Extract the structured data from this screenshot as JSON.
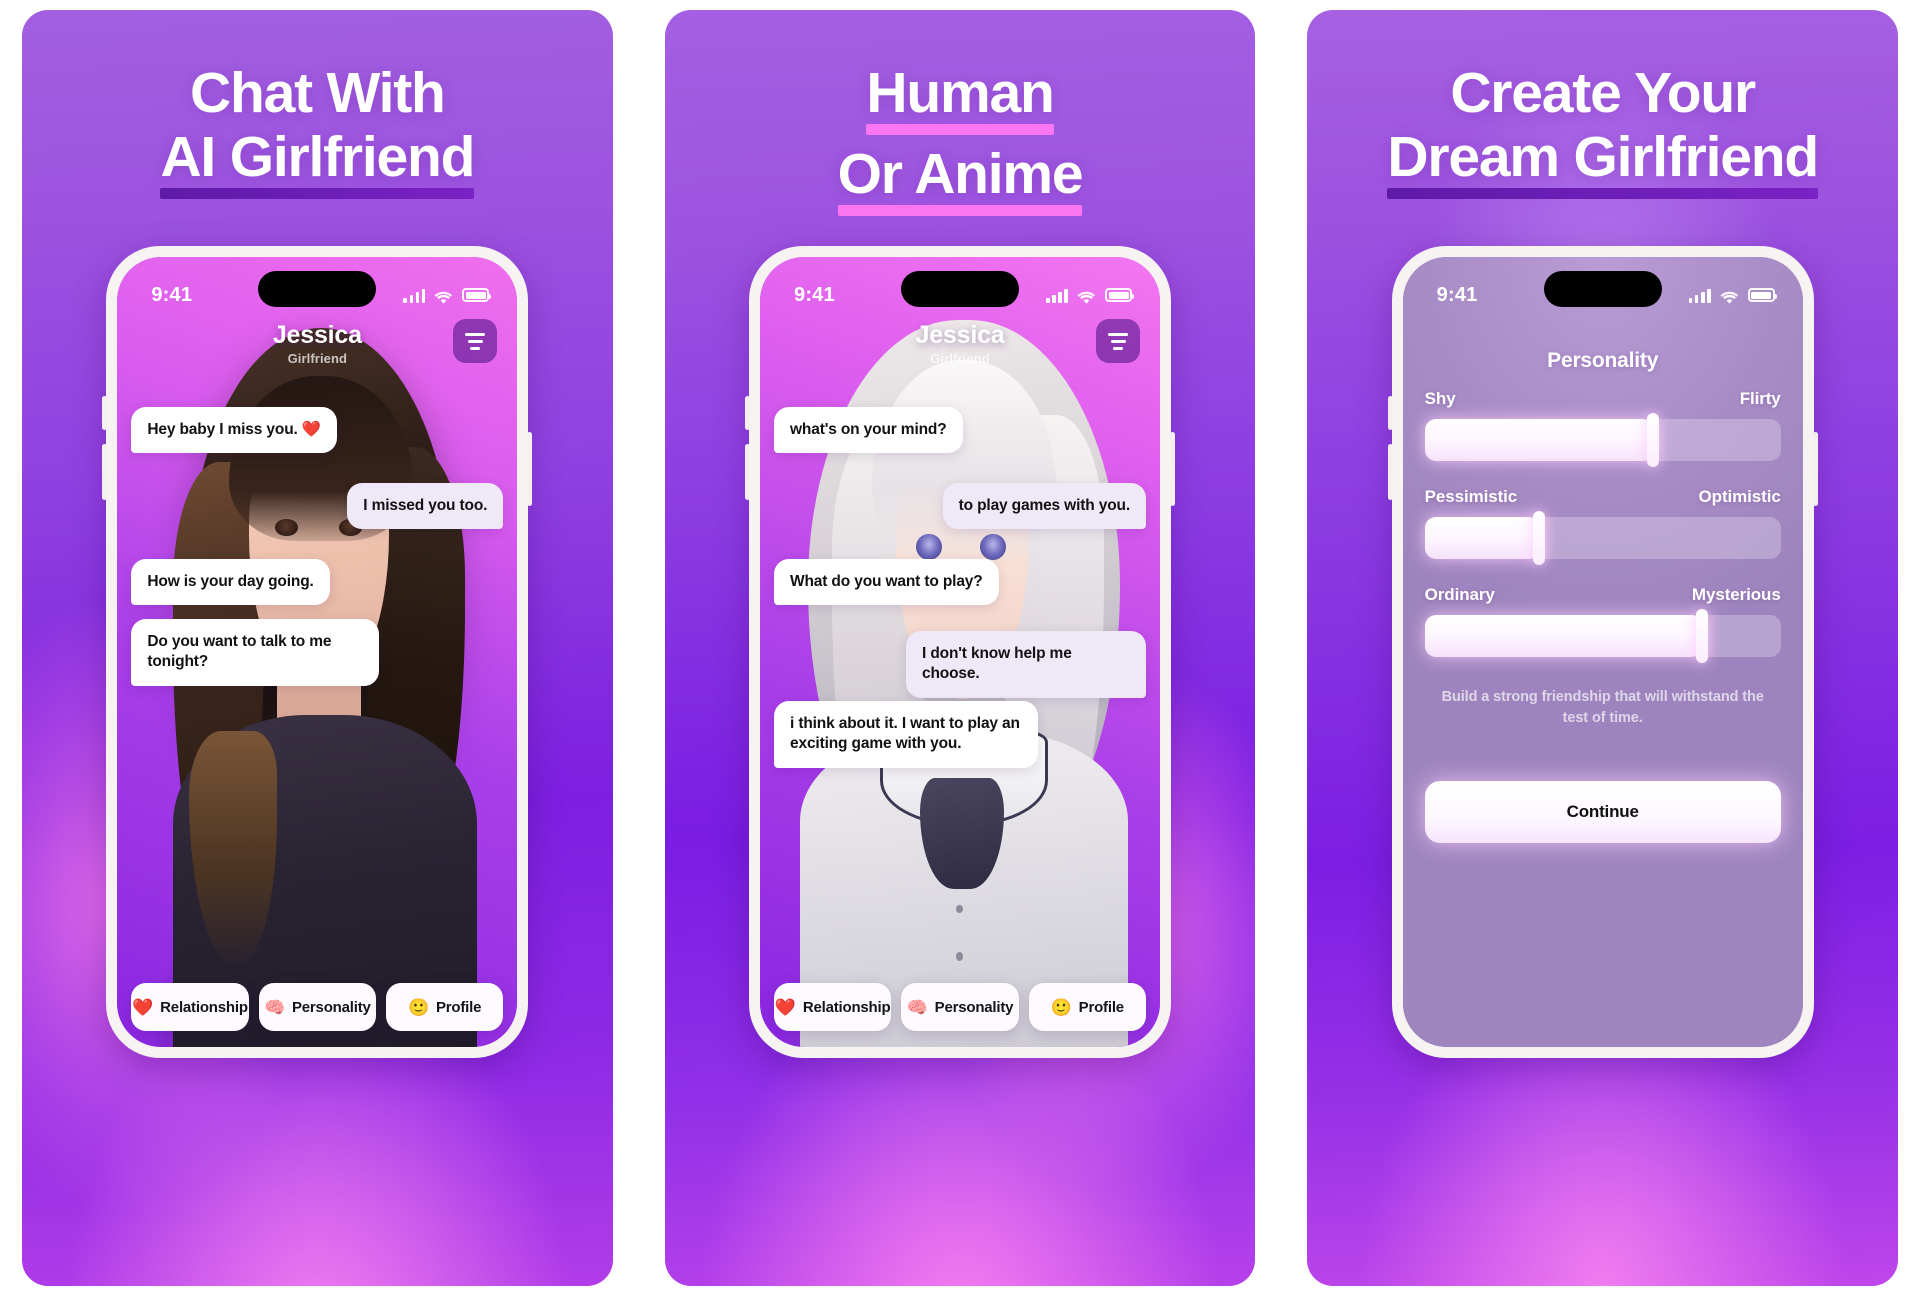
{
  "panels": [
    {
      "headline_line1": "Chat With",
      "headline_line2": "AI Girlfriend",
      "underline_color": "#6b1eb4",
      "status": {
        "time": "9:41"
      },
      "chat": {
        "name": "Jessica",
        "subtitle": "Girlfriend",
        "messages": [
          {
            "from": "in",
            "text": "Hey baby I miss you. ❤️"
          },
          {
            "from": "out",
            "text": "I missed you too."
          },
          {
            "from": "in",
            "text": "How is your day going."
          },
          {
            "from": "in",
            "text": "Do you want to talk to me tonight?"
          }
        ]
      },
      "pills": [
        {
          "emoji": "❤️",
          "label": "Relationship"
        },
        {
          "emoji": "🧠",
          "label": "Personality"
        },
        {
          "emoji": "🙂",
          "label": "Profile"
        }
      ]
    },
    {
      "headline_line1": "Human",
      "headline_line2": "Or Anime",
      "underline_color": "#fc76f4",
      "status": {
        "time": "9:41"
      },
      "chat": {
        "name": "Jessica",
        "subtitle": "Girlfriend",
        "messages": [
          {
            "from": "in",
            "text": "what's on your mind?"
          },
          {
            "from": "out",
            "text": "to play games with you."
          },
          {
            "from": "in",
            "text": "What do you want to play?"
          },
          {
            "from": "out",
            "text": "I don't know help me choose."
          },
          {
            "from": "in",
            "text": "i think about it. I want to play an exciting game with you."
          }
        ]
      },
      "pills": [
        {
          "emoji": "❤️",
          "label": "Relationship"
        },
        {
          "emoji": "🧠",
          "label": "Personality"
        },
        {
          "emoji": "🙂",
          "label": "Profile"
        }
      ]
    },
    {
      "headline_line1": "Create Your",
      "headline_line2": "Dream Girlfriend",
      "underline_color": "#6b1eb4",
      "status": {
        "time": "9:41"
      },
      "personality": {
        "title": "Personality",
        "sliders": [
          {
            "left_label": "Shy",
            "right_label": "Flirty",
            "value": 64
          },
          {
            "left_label": "Pessimistic",
            "right_label": "Optimistic",
            "value": 32
          },
          {
            "left_label": "Ordinary",
            "right_label": "Mysterious",
            "value": 78
          }
        ],
        "note": "Build a strong friendship that will withstand the test of time.",
        "continue_label": "Continue"
      }
    }
  ]
}
